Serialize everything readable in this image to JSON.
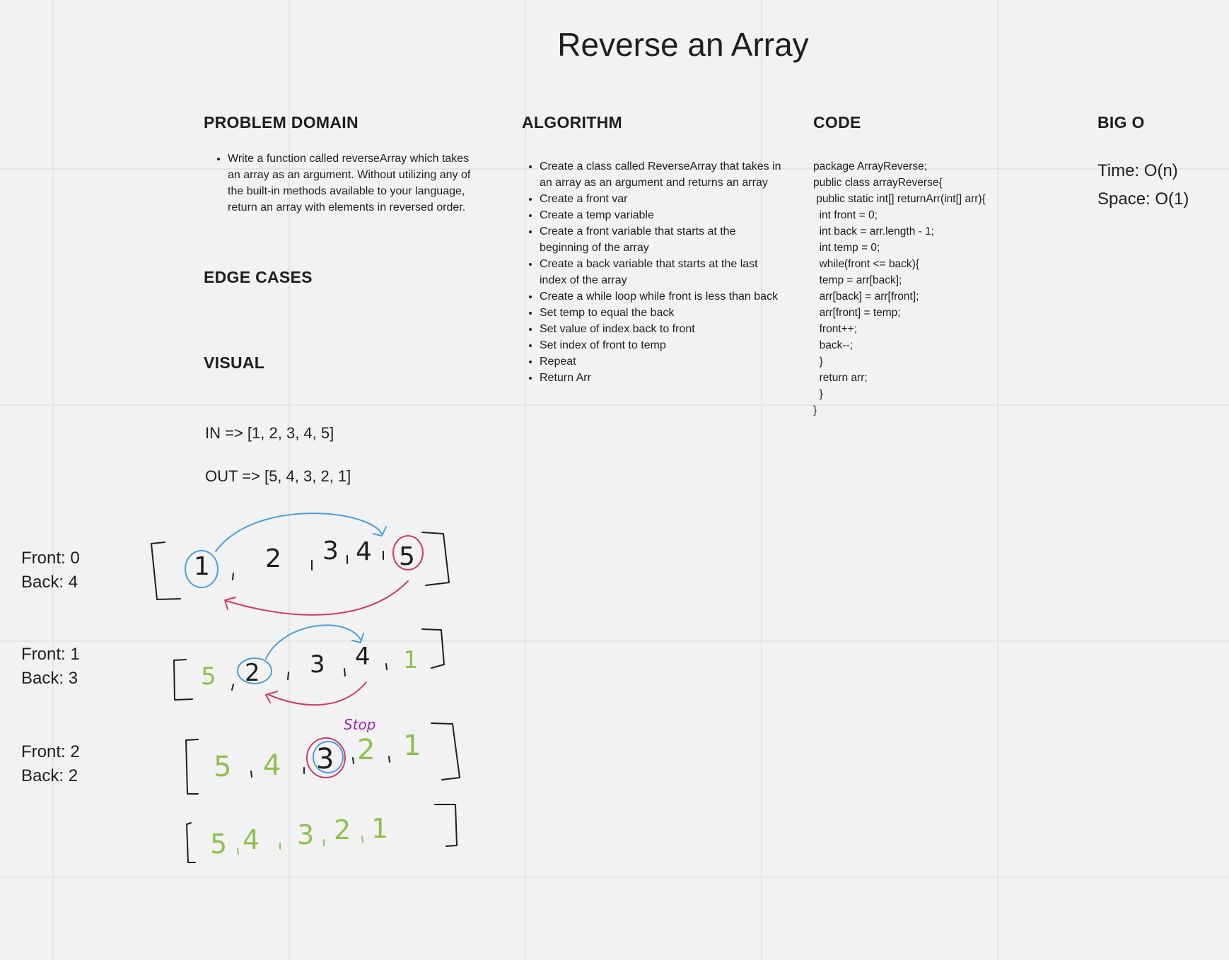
{
  "title": "Reverse an Array",
  "problem_domain": {
    "heading": "PROBLEM DOMAIN",
    "bullets": [
      "Write a function called reverseArray which takes an array as an argument. Without utilizing any of the built-in methods available to your language, return an array with elements in reversed order."
    ]
  },
  "edge_cases": {
    "heading": "EDGE CASES"
  },
  "visual": {
    "heading": "VISUAL",
    "input": "IN => [1, 2, 3, 4, 5]",
    "output": "OUT => [5, 4, 3, 2, 1]",
    "steps": [
      {
        "front": "Front: 0",
        "back": "Back: 4",
        "values": [
          "1",
          "2",
          "3",
          "4",
          "5"
        ]
      },
      {
        "front": "Front: 1",
        "back": "Back: 3",
        "values": [
          "5",
          "2",
          "3",
          "4",
          "1"
        ]
      },
      {
        "front": "Front: 2",
        "back": "Back: 2",
        "values": [
          "5",
          "4",
          "3",
          "2",
          "1"
        ]
      },
      {
        "values": [
          "5",
          "4",
          "3",
          "2",
          "1"
        ]
      }
    ],
    "stop_note": "Stop",
    "colors": {
      "front": "#4a9ee0",
      "back": "#d23a68",
      "done": "#8cc152",
      "stop": "#9c27b0"
    }
  },
  "algorithm": {
    "heading": "ALGORITHM",
    "bullets": [
      "Create a class called ReverseArray that takes in an array as an argument and returns an array",
      "Create a front var",
      "Create a temp variable",
      "Create a front variable that starts at the beginning of the array",
      "Create a back variable that starts at the last index of the array",
      "Create a while loop while front is less than back",
      "Set temp to equal the back",
      "Set value of index back to front",
      "Set index of front to temp",
      "Repeat",
      "Return Arr"
    ]
  },
  "code": {
    "heading": "CODE",
    "lines": [
      "package ArrayReverse;",
      "",
      "public class arrayReverse{",
      "",
      " public static int[] returnArr(int[] arr){",
      "  int front = 0;",
      "  int back = arr.length - 1;",
      "  int temp = 0;",
      "  while(front <= back){",
      "  temp = arr[back];",
      "  arr[back] = arr[front];",
      "  arr[front] = temp;",
      "  front++;",
      "  back--;",
      "  }",
      "  return arr;",
      "  }",
      "}"
    ]
  },
  "big_o": {
    "heading": "BIG O",
    "time": "Time: O(n)",
    "space": "Space: O(1)"
  }
}
